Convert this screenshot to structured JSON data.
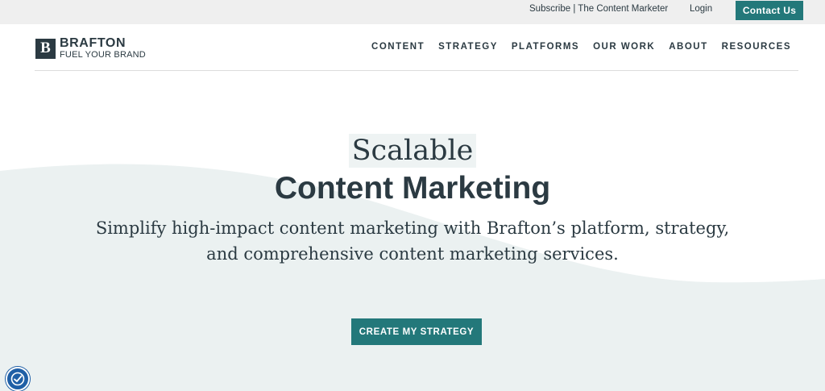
{
  "topbar": {
    "subscribe": "Subscribe | The Content Marketer",
    "login": "Login",
    "contact": "Contact Us"
  },
  "brand": {
    "mark": "B",
    "name": "BRAFTON",
    "tagline": "FUEL YOUR BRAND"
  },
  "nav": {
    "items": [
      "CONTENT",
      "STRATEGY",
      "PLATFORMS",
      "OUR WORK",
      "ABOUT",
      "RESOURCES"
    ]
  },
  "hero": {
    "line1": "Scalable",
    "line2": "Content Marketing",
    "sub_line1": "Simplify high-impact content marketing with Brafton’s platform, strategy,",
    "sub_line2": "and comprehensive content marketing services.",
    "cta": "CREATE MY STRATEGY"
  },
  "icons": {
    "logo": "brafton-logo-icon",
    "accessibility": "accessibility-icon"
  },
  "colors": {
    "accent": "#23787a",
    "text": "#2b3a42",
    "topbar_bg": "#efefef",
    "wave_bg": "#ebf1f1",
    "accessibility_bg": "#1f5fa6"
  }
}
